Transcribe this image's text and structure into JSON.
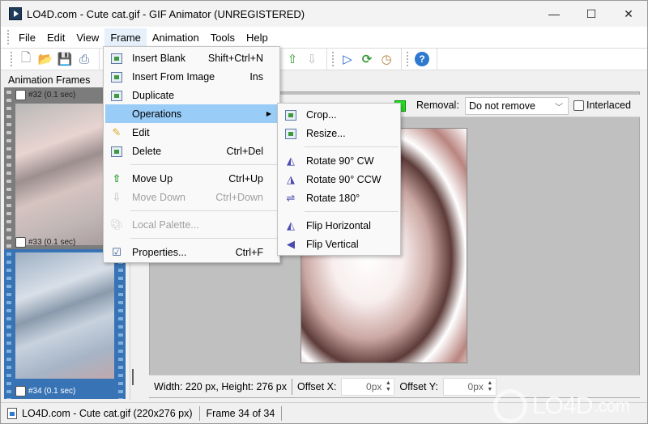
{
  "window": {
    "title": "LO4D.com - Cute cat.gif - GIF Animator (UNREGISTERED)",
    "controls": {
      "minimize": "—",
      "maximize": "☐",
      "close": "✕"
    }
  },
  "menubar": {
    "items": [
      "File",
      "Edit",
      "View",
      "Frame",
      "Animation",
      "Tools",
      "Help"
    ],
    "active": "Frame"
  },
  "toolbar": {
    "icons": {
      "new": "🗋",
      "open": "📂",
      "save": "💾",
      "scan": "⎙",
      "move_up": "⇧",
      "move_down": "⇩",
      "play": "▷",
      "loop": "⟳",
      "timer": "◷",
      "help": "?"
    }
  },
  "sidebar": {
    "title": "Animation Frames",
    "frames": [
      {
        "label": "#32 (0.1 sec)",
        "checked": false,
        "selected": false
      },
      {
        "label": "#33 (0.1 sec)",
        "checked": false,
        "selected": false
      },
      {
        "label": "#34 (0.1 sec)",
        "checked": false,
        "selected": true
      }
    ]
  },
  "frame_props": {
    "removal_label": "Removal:",
    "removal_value": "Do not remove",
    "interlaced_label": "Interlaced",
    "interlaced_checked": false,
    "transparent_color": "#22e022"
  },
  "frame_menu": {
    "items": [
      {
        "label": "Insert Blank",
        "shortcut": "Shift+Ctrl+N",
        "icon": "insert-blank-icon",
        "disabled": false
      },
      {
        "label": "Insert From Image",
        "shortcut": "Ins",
        "icon": "insert-image-icon",
        "disabled": false
      },
      {
        "label": "Duplicate",
        "shortcut": "",
        "icon": "duplicate-icon",
        "disabled": false
      },
      {
        "label": "Operations",
        "shortcut": "",
        "icon": "",
        "disabled": false,
        "submenu": true,
        "highlighted": true
      },
      {
        "label": "Edit",
        "shortcut": "",
        "icon": "edit-icon",
        "disabled": false
      },
      {
        "label": "Delete",
        "shortcut": "Ctrl+Del",
        "icon": "delete-icon",
        "disabled": false
      },
      {
        "label": "Move Up",
        "shortcut": "Ctrl+Up",
        "icon": "move-up-icon",
        "disabled": false
      },
      {
        "label": "Move Down",
        "shortcut": "Ctrl+Down",
        "icon": "move-down-icon",
        "disabled": true
      },
      {
        "label": "Local Palette...",
        "shortcut": "",
        "icon": "palette-icon",
        "disabled": true
      },
      {
        "label": "Properties...",
        "shortcut": "Ctrl+F",
        "icon": "properties-icon",
        "disabled": false
      }
    ]
  },
  "operations_menu": {
    "items": [
      {
        "label": "Crop...",
        "icon": "crop-icon"
      },
      {
        "label": "Resize...",
        "icon": "resize-icon"
      },
      {
        "label": "Rotate 90° CW",
        "icon": "rotate-cw-icon"
      },
      {
        "label": "Rotate 90° CCW",
        "icon": "rotate-ccw-icon"
      },
      {
        "label": "Rotate 180°",
        "icon": "rotate-180-icon"
      },
      {
        "label": "Flip Horizontal",
        "icon": "flip-horizontal-icon"
      },
      {
        "label": "Flip Vertical",
        "icon": "flip-vertical-icon"
      }
    ]
  },
  "frame_info": {
    "dimensions": "Width: 220 px, Height: 276 px",
    "offset_x_label": "Offset X:",
    "offset_x_value": "0px",
    "offset_y_label": "Offset Y:",
    "offset_y_value": "0px"
  },
  "statusbar": {
    "file": "LO4D.com - Cute cat.gif (220x276 px)",
    "frame": "Frame 34 of 34"
  },
  "watermark": {
    "text": "LO4D",
    "suffix": ".com"
  }
}
